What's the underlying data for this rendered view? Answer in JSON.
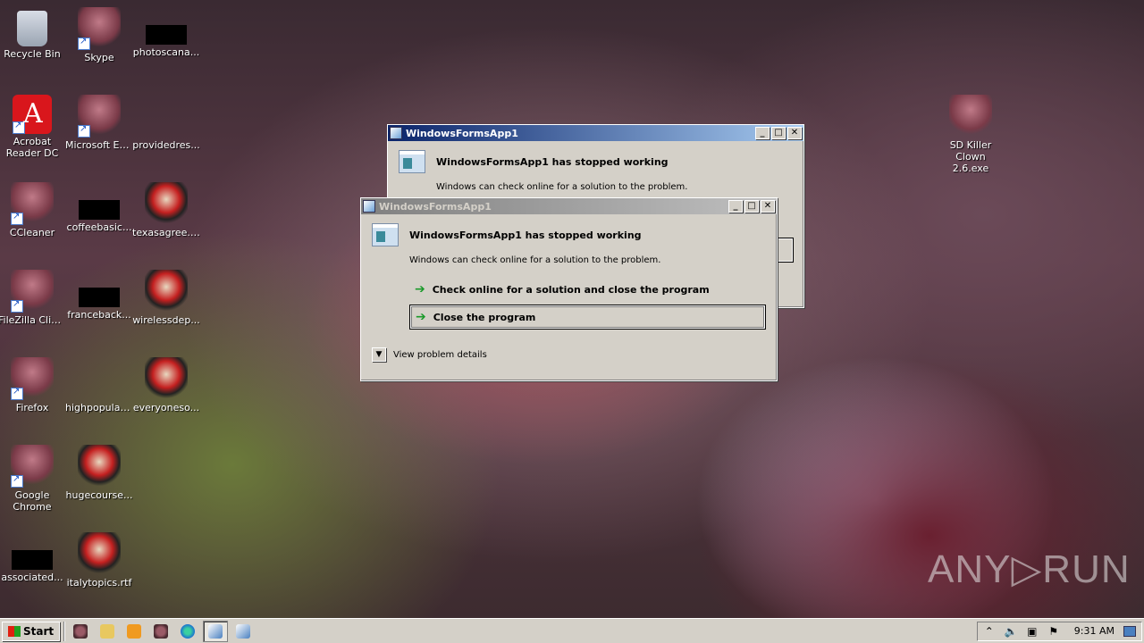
{
  "desktop": {
    "icons": [
      {
        "label": "Recycle Bin"
      },
      {
        "label": "Skype"
      },
      {
        "label": "photoscana..."
      },
      {
        "label": "Acrobat Reader DC"
      },
      {
        "label": "Microsoft Edge"
      },
      {
        "label": "providedres..."
      },
      {
        "label": "CCleaner"
      },
      {
        "label": "coffeebasic..."
      },
      {
        "label": "texasagree.rtf"
      },
      {
        "label": "FileZilla Client"
      },
      {
        "label": "franceback..."
      },
      {
        "label": "wirelessdep..."
      },
      {
        "label": "Firefox"
      },
      {
        "label": "highpopulati..."
      },
      {
        "label": "everyoneso..."
      },
      {
        "label": "Google Chrome"
      },
      {
        "label": "hugecourse..."
      },
      {
        "label": "associated..."
      },
      {
        "label": "italytopics.rtf"
      },
      {
        "label": "SD Killer Clown 2.6.exe"
      }
    ]
  },
  "dialog_back": {
    "title": "WindowsFormsApp1",
    "heading": "WindowsFormsApp1 has stopped working",
    "subtext": "Windows can check online for a solution to the problem."
  },
  "dialog_front": {
    "title": "WindowsFormsApp1",
    "heading": "WindowsFormsApp1 has stopped working",
    "subtext": "Windows can check online for a solution to the problem.",
    "option_check": "Check online for a solution and close the program",
    "option_close": "Close the program",
    "details": "View problem details"
  },
  "window_buttons": {
    "minimize": "_",
    "maximize": "□",
    "close": "✕"
  },
  "taskbar": {
    "start_label": "Start",
    "clock": "9:31 AM"
  },
  "watermark": "ANY▷RUN"
}
